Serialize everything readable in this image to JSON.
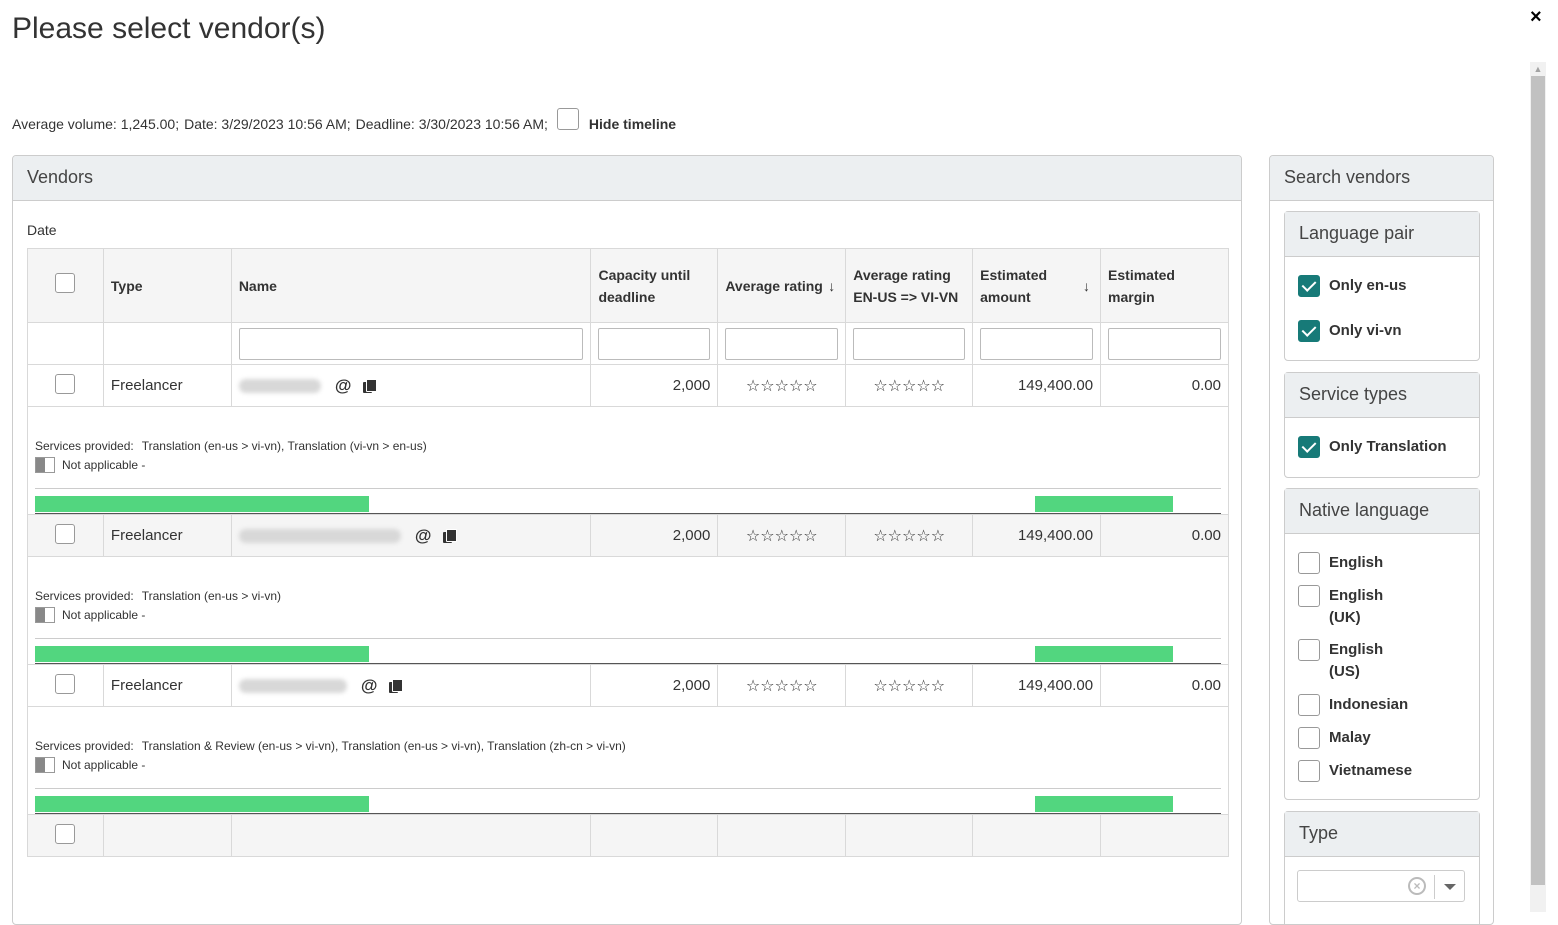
{
  "dialog": {
    "title": "Please select vendor(s)",
    "close": "×"
  },
  "info": {
    "avg_volume": "Average volume: 1,245.00;",
    "date": "Date: 3/29/2023 10:56 AM;",
    "deadline": "Deadline: 3/30/2023 10:56 AM;",
    "hide_timeline": "Hide timeline"
  },
  "vendors": {
    "title": "Vendors",
    "date_label": "Date",
    "columns": {
      "type": "Type",
      "name": "Name",
      "capacity": "Capacity until deadline",
      "avg_rating": "Average rating",
      "avg_rating_pair": "Average rating EN-US => VI-VN",
      "est_amount": "Estimated amount",
      "est_margin": "Estimated margin",
      "sort_arrow": "↓"
    },
    "rows": [
      {
        "type": "Freelancer",
        "capacity": "2,000",
        "rating": "☆☆☆☆☆",
        "rating_pair": "☆☆☆☆☆",
        "amount": "149,400.00",
        "margin": "0.00",
        "services_label": "Services provided:",
        "services": "Translation (en-us > vi-vn), Translation (vi-vn > en-us)",
        "not_applicable": "Not applicable -"
      },
      {
        "type": "Freelancer",
        "capacity": "2,000",
        "rating": "☆☆☆☆☆",
        "rating_pair": "☆☆☆☆☆",
        "amount": "149,400.00",
        "margin": "0.00",
        "services_label": "Services provided:",
        "services": "Translation (en-us > vi-vn)",
        "not_applicable": "Not applicable -"
      },
      {
        "type": "Freelancer",
        "capacity": "2,000",
        "rating": "☆☆☆☆☆",
        "rating_pair": "☆☆☆☆☆",
        "amount": "149,400.00",
        "margin": "0.00",
        "services_label": "Services provided:",
        "services": "Translation & Review (en-us > vi-vn), Translation (en-us > vi-vn), Translation (zh-cn > vi-vn)",
        "not_applicable": "Not applicable -"
      }
    ],
    "email_icon": "@"
  },
  "search": {
    "title": "Search vendors",
    "language_pair": {
      "title": "Language pair",
      "options": [
        "Only en-us",
        "Only vi-vn"
      ]
    },
    "service_types": {
      "title": "Service types",
      "options": [
        "Only Translation"
      ]
    },
    "native_language": {
      "title": "Native language",
      "options": [
        "English",
        "English (UK)",
        "English (US)",
        "Indonesian",
        "Malay",
        "Vietnamese"
      ]
    },
    "type": {
      "title": "Type",
      "clear": "×"
    }
  },
  "colors": {
    "accent": "#177a78",
    "timeline_bar": "#52d67f"
  }
}
